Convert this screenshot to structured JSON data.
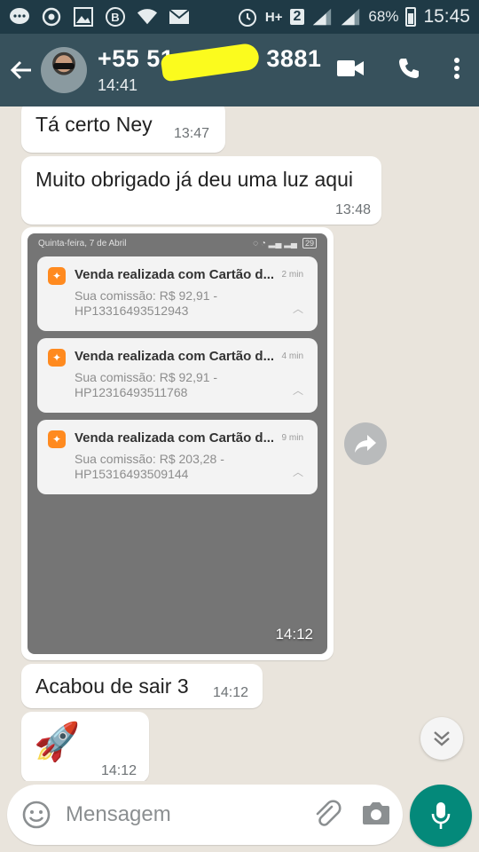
{
  "status_bar": {
    "battery_percent": "68%",
    "time": "15:45",
    "network_type": "H+",
    "sim_number": "2"
  },
  "header": {
    "contact_name": "+55 51",
    "contact_name_end": "3881",
    "subtitle": "14:41"
  },
  "messages": [
    {
      "text": "Tá certo Ney",
      "time": "13:47"
    },
    {
      "text": "Muito obrigado já deu uma luz aqui",
      "time": "13:48"
    },
    {
      "text": "Acabou de sair 3",
      "time": "14:12"
    },
    {
      "text": "🚀",
      "time": "14:12"
    }
  ],
  "image_message": {
    "time": "14:12",
    "screenshot": {
      "date": "Quinta-feira, 7 de Abril",
      "battery": "29",
      "notifications": [
        {
          "title": "Venda realizada com Cartão d...",
          "ago": "2 min",
          "line1": "Sua comissão: R$ 92,91 -",
          "line2": "HP13316493512943"
        },
        {
          "title": "Venda realizada com Cartão d...",
          "ago": "4 min",
          "line1": "Sua comissão: R$ 92,91 -",
          "line2": "HP12316493511768"
        },
        {
          "title": "Venda realizada com Cartão d...",
          "ago": "9 min",
          "line1": "Sua comissão: R$ 203,28 -",
          "line2": "HP15316493509144"
        }
      ]
    }
  },
  "composer": {
    "placeholder": "Mensagem"
  },
  "colors": {
    "header": "#37515c",
    "status_bar": "#1f3a46",
    "chat_bg": "#e9e4dc",
    "send_button": "#04897a"
  }
}
